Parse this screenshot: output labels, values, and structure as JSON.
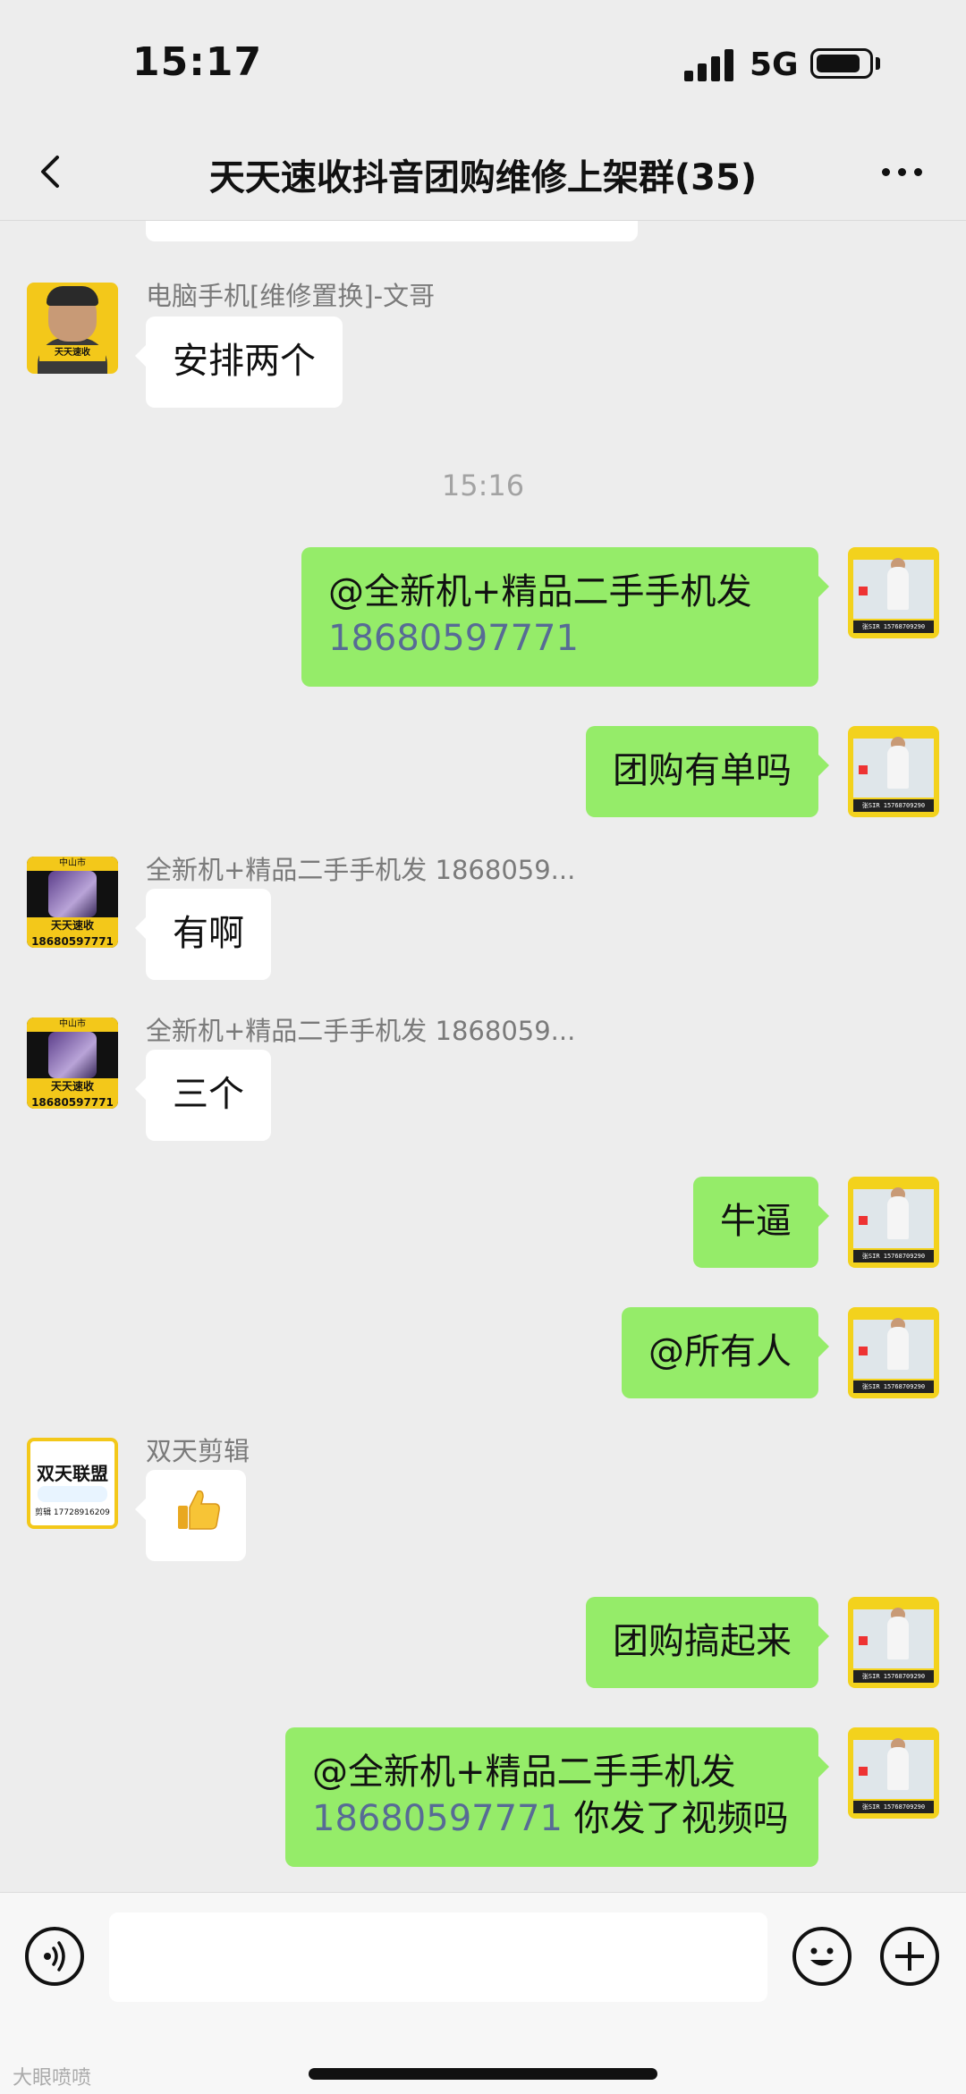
{
  "status_bar": {
    "time": "15:17",
    "network": "5G"
  },
  "header": {
    "title": "天天速收抖音团购维修上架群(35)"
  },
  "messages": {
    "m0": {
      "text": "...................."
    },
    "m1": {
      "sender": "电脑手机[维修置换]-文哥",
      "text": "安排两个",
      "avatar_tag": "天天速收"
    },
    "time1": "15:16",
    "m2": {
      "text_line1": "@全新机+精品二手手机发",
      "phone": "18680597771",
      "text_after": ""
    },
    "m3": {
      "text": "团购有单吗"
    },
    "m4": {
      "sender": "全新机+精品二手手机发 1868059...",
      "text": "有啊",
      "avatar_city": "中山市",
      "avatar_label": "天天速收\n18680597771"
    },
    "m5": {
      "sender": "全新机+精品二手手机发 1868059...",
      "text": "三个",
      "avatar_city": "中山市",
      "avatar_label": "天天速收\n18680597771"
    },
    "m6": {
      "text": "牛逼"
    },
    "m7": {
      "text": "@所有人"
    },
    "m8": {
      "sender": "双天剪辑",
      "emoji": "thumbs-up",
      "avatar_title": "双天联盟",
      "avatar_phone": "剪辑 17728916209"
    },
    "m9": {
      "text": "团购搞起来"
    },
    "m10": {
      "text_line1": "@全新机+精品二手手机发",
      "phone": "18680597771",
      "text_after": " 你发了视频吗"
    }
  },
  "my_avatar": {
    "strip": "张SIR 15768709290"
  },
  "input": {
    "placeholder": ""
  },
  "watermark": "大眼喷喷",
  "colors": {
    "my_bubble": "#95ec69",
    "other_bubble": "#ffffff",
    "link": "#576b95",
    "background": "#ededed"
  }
}
